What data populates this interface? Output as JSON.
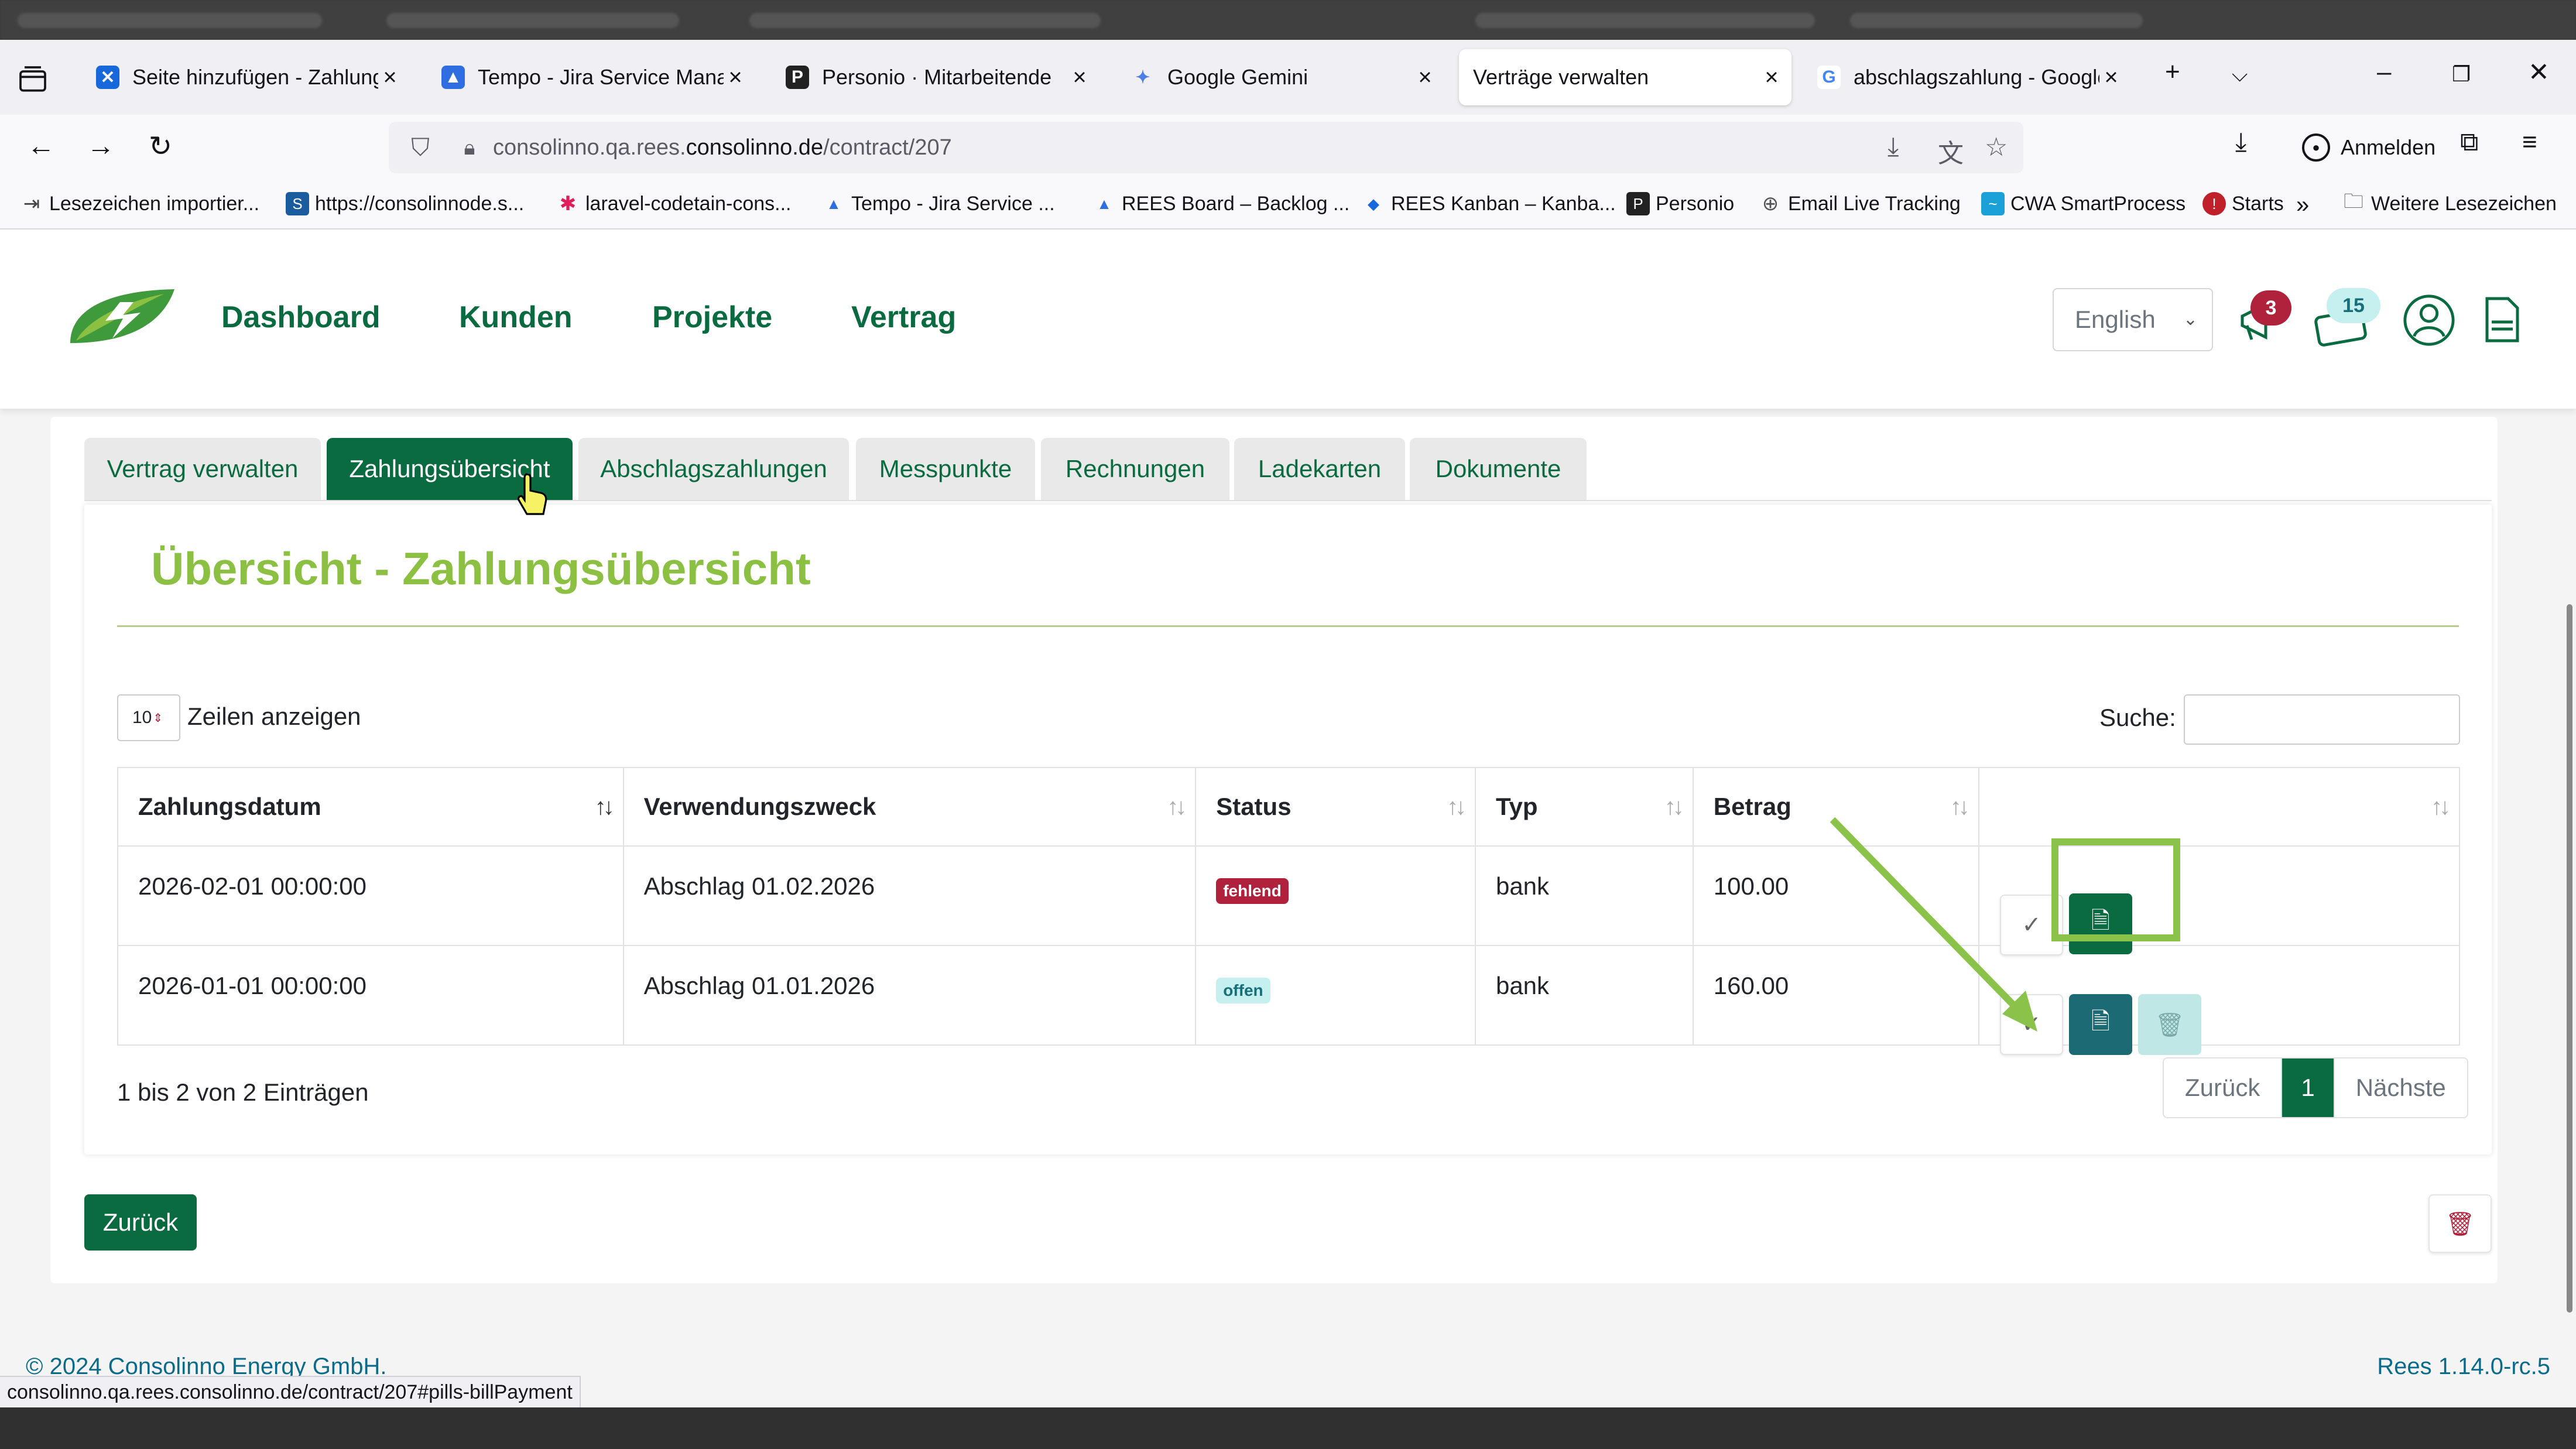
{
  "browser": {
    "tabs": [
      {
        "label": "Seite hinzufügen - Zahlungs",
        "fav_color": "#1868db",
        "fav_glyph": "✕"
      },
      {
        "label": "Tempo - Jira Service Manage",
        "fav_color": "#2f6ee0",
        "fav_glyph": "▲"
      },
      {
        "label": "Personio · Mitarbeitende",
        "fav_color": "#222222",
        "fav_glyph": "P"
      },
      {
        "label": "Google Gemini",
        "fav_color": "#4f7de8",
        "fav_glyph": "✦"
      },
      {
        "label": "Verträge verwalten",
        "fav_color": "",
        "fav_glyph": ""
      },
      {
        "label": "abschlagszahlung - Google",
        "fav_color": "#ffffff",
        "fav_glyph": "G"
      }
    ],
    "url_prefix": "consolinno.qa.rees.",
    "url_domain": "consolinno.de",
    "url_path": "/contract/207",
    "signin_label": "Anmelden",
    "bookmarks": [
      {
        "label": "Lesezeichen importier...",
        "color": "#444444"
      },
      {
        "label": "https://consolinnode.s...",
        "color": "#1a5c9e"
      },
      {
        "label": "laravel-codetain-cons...",
        "color": "#e01e5a"
      },
      {
        "label": "Tempo - Jira Service ...",
        "color": "#2f6ee0"
      },
      {
        "label": "REES Board – Backlog ...",
        "color": "#2f6ee0"
      },
      {
        "label": "REES Kanban – Kanba...",
        "color": "#1868db"
      },
      {
        "label": "Personio",
        "color": "#222222"
      },
      {
        "label": "Email Live Tracking",
        "color": "#555555"
      },
      {
        "label": "CWA SmartProcess",
        "color": "#1ba0d8"
      },
      {
        "label": "Starts",
        "color": "#c0202a"
      }
    ],
    "more_bookmarks_label": "Weitere Lesezeichen",
    "status_url": "consolinno.qa.rees.consolinno.de/contract/207#pills-billPayment"
  },
  "app": {
    "nav": [
      "Dashboard",
      "Kunden",
      "Projekte",
      "Vertrag"
    ],
    "language": "English",
    "notifications_count": "3",
    "messages_count": "15",
    "tabs": [
      "Vertrag verwalten",
      "Zahlungsübersicht",
      "Abschlagszahlungen",
      "Messpunkte",
      "Rechnungen",
      "Ladekarten",
      "Dokumente"
    ],
    "active_tab": "Zahlungsübersicht",
    "section_title": "Übersicht - Zahlungsübersicht",
    "length_value": "10",
    "length_label": "Zeilen anzeigen",
    "search_label": "Suche:",
    "search_value": "",
    "columns": [
      "Zahlungsdatum",
      "Verwendungszweck",
      "Status",
      "Typ",
      "Betrag",
      ""
    ],
    "rows": [
      {
        "date": "2026-02-01 00:00:00",
        "purpose": "Abschlag 01.02.2026",
        "status": "fehlend",
        "status_color": "#b0213b",
        "type": "bank",
        "amount": "100.00"
      },
      {
        "date": "2026-01-01 00:00:00",
        "purpose": "Abschlag 01.01.2026",
        "status": "offen",
        "status_color": "#c6efef",
        "type": "bank",
        "amount": "160.00"
      }
    ],
    "info": "1 bis 2 von 2 Einträgen",
    "pager": {
      "prev": "Zurück",
      "current": "1",
      "next": "Nächste"
    },
    "back_button": "Zurück",
    "footer_copyright": "© 2024 Consolinno Energy GmbH.",
    "footer_version": "Rees 1.14.0-rc.5",
    "accent_color": "#0b6b40",
    "title_color": "#8bc043"
  }
}
